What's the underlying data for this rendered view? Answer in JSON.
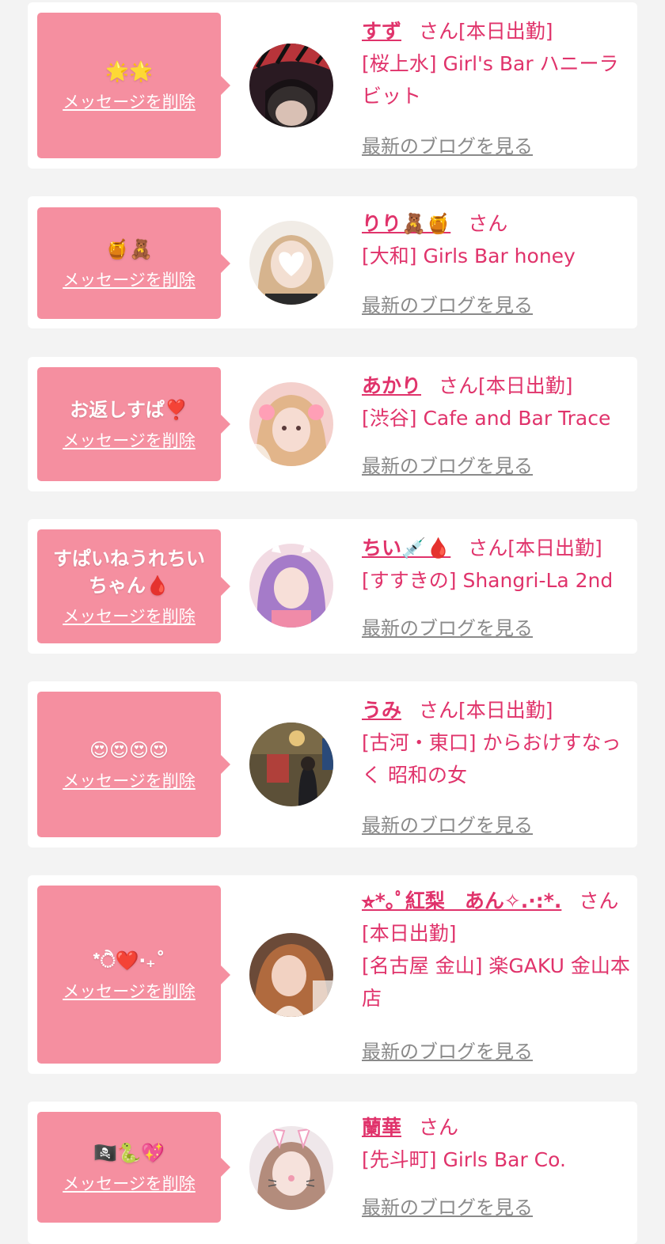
{
  "entries": [
    {
      "message": "🌟🌟",
      "delete_label": "メッセージを削除",
      "name": "すず",
      "san": "さん",
      "status": "[本日出勤]",
      "area": "[桜上水]",
      "shop": "Girl's Bar ハニーラビット",
      "blog_label": "最新のブログを見る",
      "avatar_colors": [
        "#3a1e2a",
        "#c23a3a",
        "#1a1a1a"
      ]
    },
    {
      "message": "🍯🧸",
      "delete_label": "メッセージを削除",
      "name": "りり🧸🍯",
      "san": "さん",
      "status": "",
      "area": "[大和]",
      "shop": "Girls Bar honey",
      "blog_label": "最新のブログを見る",
      "avatar_colors": [
        "#e9dccc",
        "#c9a27a",
        "#ffffff"
      ]
    },
    {
      "message": "お返しすぱ❣️",
      "delete_label": "メッセージを削除",
      "name": "あかり",
      "san": "さん",
      "status": "[本日出勤]",
      "area": "[渋谷]",
      "shop": "Cafe and Bar Trace",
      "blog_label": "最新のブログを見る",
      "avatar_colors": [
        "#f2c7c7",
        "#d9a47f",
        "#ffeaea"
      ]
    },
    {
      "message": "すぱいねうれちいちゃん🩸",
      "delete_label": "メッセージを削除",
      "name": "ちい💉🩸",
      "san": "さん",
      "status": "[本日出勤]",
      "area": "[すすきの]",
      "shop": "Shangri-La 2nd",
      "blog_label": "最新のブログを見る",
      "avatar_colors": [
        "#e7b8d6",
        "#b48ad4",
        "#f4d4e2"
      ]
    },
    {
      "message": "😍😍😍😍",
      "delete_label": "メッセージを削除",
      "name": "うみ",
      "san": "さん",
      "status": "[本日出勤]",
      "area": "[古河・東口]",
      "shop": "からおけすなっく 昭和の女",
      "blog_label": "最新のブログを見る",
      "avatar_colors": [
        "#6b5a3d",
        "#a84a3a",
        "#2c3b2a"
      ]
    },
    {
      "message": "*ੈ❤️‧₊˚",
      "delete_label": "メッセージを削除",
      "name": "⭐︎*｡ﾟ紅梨　あん✧.·:*.",
      "san": "さん",
      "status": "[本日出勤]",
      "area": "[名古屋 金山]",
      "shop": "楽GAKU 金山本店",
      "blog_label": "最新のブログを見る",
      "avatar_colors": [
        "#8a5a40",
        "#e0b39a",
        "#4a2e22"
      ]
    },
    {
      "message": "🏴‍☠️🐍💖",
      "delete_label": "メッセージを削除",
      "name": "蘭華",
      "san": "さん",
      "status": "",
      "area": "[先斗町]",
      "shop": "Girls Bar Co.",
      "blog_label": "最新のブログを見る",
      "avatar_colors": [
        "#e8e0e6",
        "#d8c0b6",
        "#ffffff"
      ]
    }
  ]
}
